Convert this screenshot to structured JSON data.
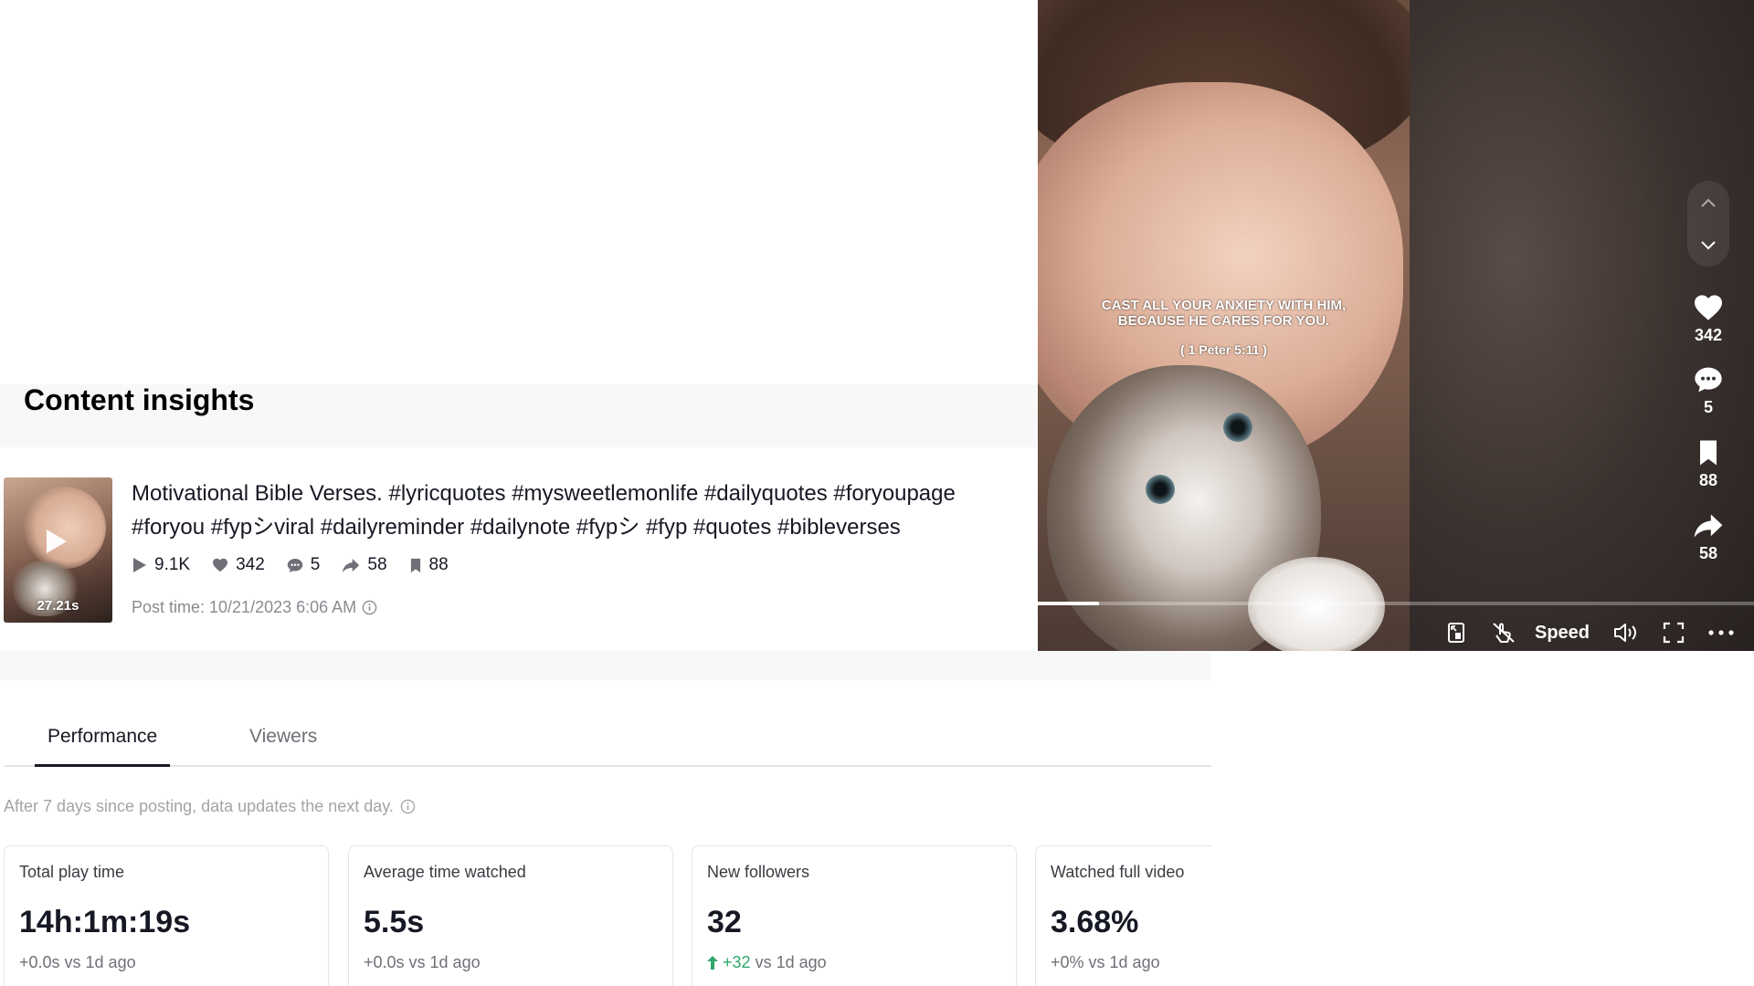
{
  "insights": {
    "title": "Content insights"
  },
  "post": {
    "thumbnail_duration": "27.21s",
    "caption": "Motivational Bible Verses. #lyricquotes #mysweetlemonlife #dailyquotes #foryoupage #foryou #fypシviral #dailyreminder #dailynote #fypシ #fyp #quotes #bibleverses",
    "stats": {
      "views": "9.1K",
      "likes": "342",
      "comments": "5",
      "shares": "58",
      "saves": "88"
    },
    "post_time": "Post time: 10/21/2023 6:06 AM"
  },
  "tabs": [
    {
      "label": "Performance",
      "active": true
    },
    {
      "label": "Viewers",
      "active": false
    }
  ],
  "update_note": "After 7 days since posting, data updates the next day.",
  "metrics": [
    {
      "label": "Total play time",
      "value": "14h:1m:19s",
      "delta": "+0.0s vs 1d ago"
    },
    {
      "label": "Average time watched",
      "value": "5.5s",
      "delta": "+0.0s vs 1d ago"
    },
    {
      "label": "New followers",
      "value": "32",
      "delta_up": "+32",
      "delta_rest": " vs 1d ago"
    },
    {
      "label": "Watched full video",
      "value": "3.68%",
      "delta": "+0% vs 1d ago"
    }
  ],
  "player": {
    "caption_line1": "CAST ALL YOUR ANXIETY WITH HIM,",
    "caption_line2": "BECAUSE HE CARES FOR YOU.",
    "reference": "( 1 Peter 5:11 )",
    "progress": 0.085,
    "speed_label": "Speed",
    "actions": {
      "likes": "342",
      "comments": "5",
      "saves": "88",
      "shares": "58"
    }
  },
  "colors": {
    "accent_green": "#2fa66b",
    "text_primary": "#161823",
    "text_secondary": "#8a8b91"
  },
  "icons": [
    "play-icon",
    "heart-icon",
    "comment-icon",
    "share-icon",
    "bookmark-icon",
    "info-icon",
    "chevron-up-icon",
    "chevron-down-icon",
    "pip-icon",
    "auto-scroll-icon",
    "volume-icon",
    "fullscreen-icon",
    "more-icon",
    "arrow-up-icon"
  ]
}
